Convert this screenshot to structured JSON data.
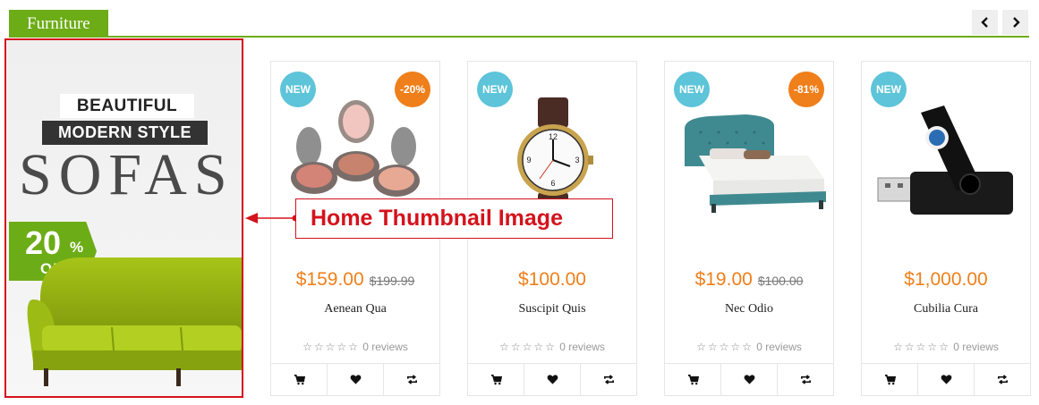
{
  "header": {
    "tab_label": "Furniture",
    "accent_color": "#6cac16",
    "prev_icon": "chevron-left-icon",
    "next_icon": "chevron-right-icon"
  },
  "banner": {
    "line1": "BEAUTIFUL",
    "line2": "MODERN STYLE",
    "line3": "SOFAS",
    "discount_value": "20",
    "discount_sign": "%",
    "discount_off": "OFF",
    "image": "green-sofa"
  },
  "annotation": {
    "text": "Home Thumbnail Image",
    "color": "#d4121b"
  },
  "products": [
    {
      "badge_new": "NEW",
      "badge_sale": "-20%",
      "image": "makeup-compacts",
      "price": "$159.00",
      "old_price": "$199.99",
      "name": "Aenean Qua",
      "rating": 0,
      "reviews": "0 reviews"
    },
    {
      "badge_new": "NEW",
      "badge_sale": "",
      "image": "wrist-watch",
      "price": "$100.00",
      "old_price": "",
      "name": "Suscipit Quis",
      "rating": 0,
      "reviews": "0 reviews"
    },
    {
      "badge_new": "NEW",
      "badge_sale": "-81%",
      "image": "bed",
      "price": "$19.00",
      "old_price": "$100.00",
      "name": "Nec Odio",
      "rating": 0,
      "reviews": "0 reviews"
    },
    {
      "badge_new": "NEW",
      "badge_sale": "",
      "image": "usb-flash-drive",
      "price": "$1,000.00",
      "old_price": "",
      "name": "Cubilia Cura",
      "rating": 0,
      "reviews": "0 reviews"
    }
  ],
  "actions": {
    "cart_icon": "cart-icon",
    "wishlist_icon": "heart-icon",
    "compare_icon": "compare-icon"
  },
  "colors": {
    "price": "#ef7f1a",
    "badge_new": "#5dc4d9",
    "badge_sale": "#ef7f1a"
  }
}
